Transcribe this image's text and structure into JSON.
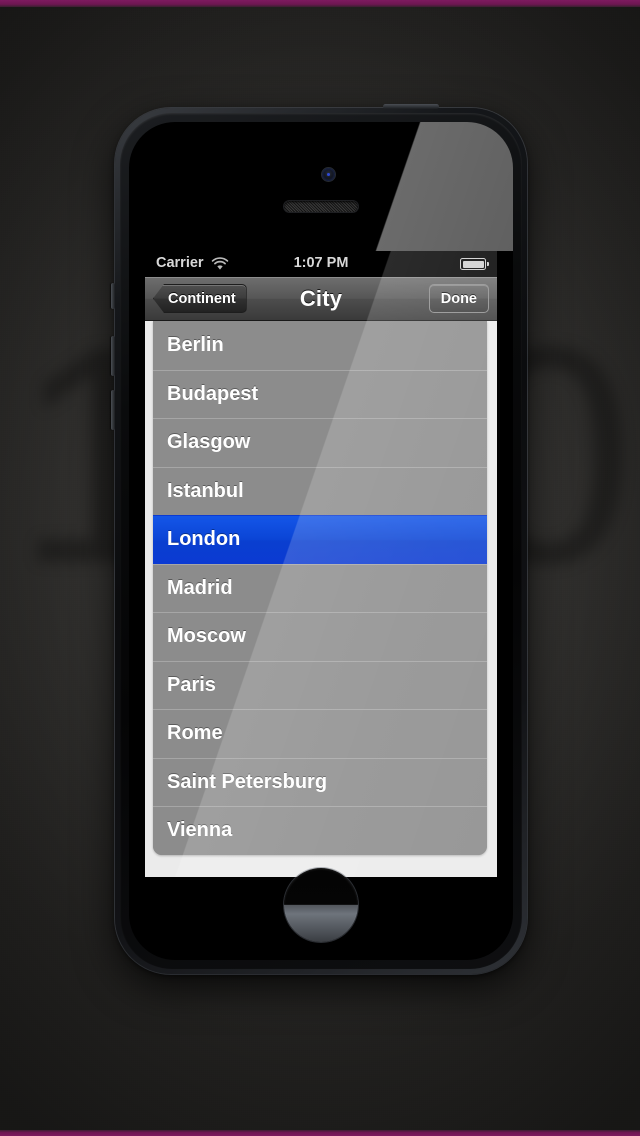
{
  "statusbar": {
    "carrier": "Carrier",
    "time": "1:07 PM",
    "wifi_icon": "wifi-icon",
    "battery_icon": "battery-full-icon"
  },
  "navbar": {
    "back_label": "Continent",
    "title": "City",
    "done_label": "Done"
  },
  "list": {
    "selected_index": 4,
    "items": [
      {
        "label": "Berlin"
      },
      {
        "label": "Budapest"
      },
      {
        "label": "Glasgow"
      },
      {
        "label": "Istanbul"
      },
      {
        "label": "London"
      },
      {
        "label": "Madrid"
      },
      {
        "label": "Moscow"
      },
      {
        "label": "Paris"
      },
      {
        "label": "Rome"
      },
      {
        "label": "Saint Petersburg"
      },
      {
        "label": "Vienna"
      }
    ]
  },
  "device": {
    "camera_icon": "front-camera-icon",
    "earpiece_icon": "earpiece-speaker-icon",
    "home_button_icon": "home-button-icon",
    "power_button_icon": "power-button-icon",
    "volume_up_icon": "volume-up-button-icon",
    "volume_down_icon": "volume-down-button-icon",
    "mute_switch_icon": "mute-switch-icon"
  },
  "backdrop": {
    "watermark_left": "1",
    "watermark_right": "0",
    "accent_color": "#7d1a5f",
    "selection_color": "#0b45d6",
    "row_color": "#8c8c8c"
  }
}
